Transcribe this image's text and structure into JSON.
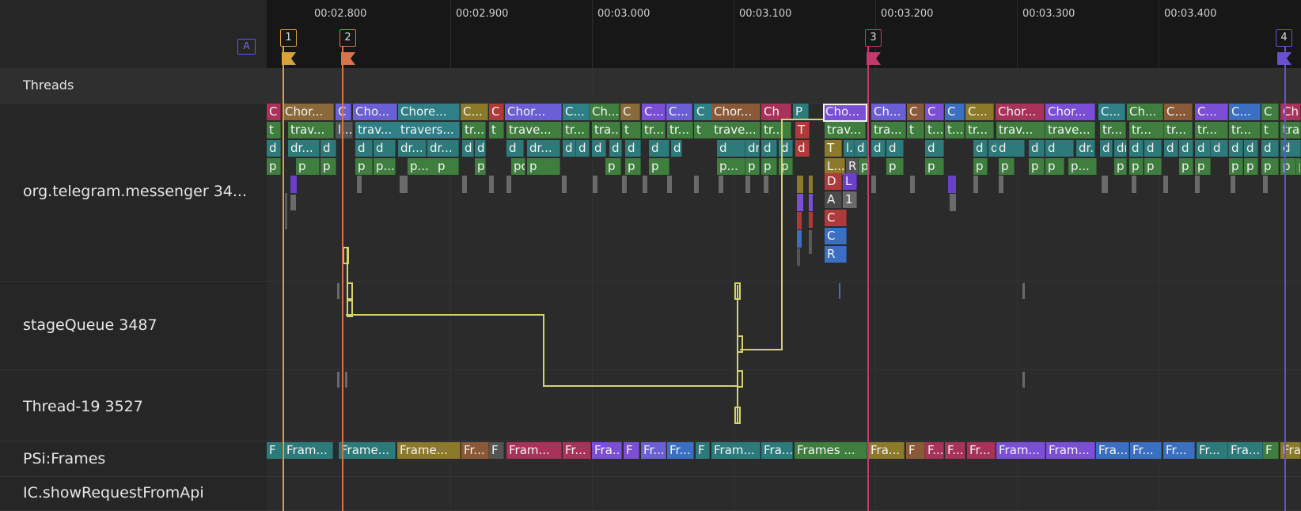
{
  "ruler": {
    "ticks": [
      "00:02.800",
      "00:02.900",
      "00:03.000",
      "00:03.100",
      "00:03.200",
      "00:03.300",
      "00:03.400"
    ]
  },
  "area_badge": "A",
  "flags": [
    "1",
    "2",
    "3",
    "4"
  ],
  "tracks": {
    "threads_section": "Threads",
    "telegram": "org.telegram.messenger 34...",
    "stage_queue": "stageQueue 3487",
    "thread19": "Thread-19 3527",
    "psi_frames": "PSi:Frames",
    "ic_show": "IC.showRequestFromApi"
  },
  "slices": {
    "row0": [
      "C",
      "Chor...",
      "C",
      "Cho...",
      "Chore...",
      "C...",
      "C",
      "Chor...",
      "C...",
      "Ch...",
      "C",
      "C...",
      "C...",
      "C",
      "Chor...",
      "Ch",
      "P",
      "Cho...",
      "Ch...",
      "C",
      "C",
      "C",
      "C...",
      "Chor...",
      "Chor...",
      "C...",
      "Ch...",
      "C...",
      "C...",
      "C...",
      "C",
      "Ch"
    ],
    "row1": [
      "t",
      "trav...",
      "l...",
      "trav...",
      "travers...",
      "tr...",
      "t",
      "trave...",
      "tr...",
      "tra...",
      "t",
      "tr...",
      "tr...",
      "t",
      "trave...",
      "tr...",
      "T",
      "trav...",
      "tra...",
      "t",
      "t...",
      "t...",
      "tr...",
      "trav...",
      "trave...",
      "tr...",
      "tr...",
      "tr...",
      "tr...",
      "tr...",
      "t",
      "tra"
    ],
    "row2": [
      "d",
      "dr...",
      "d",
      "d",
      "d",
      "dr...",
      "dr...",
      "d",
      "d",
      "d",
      "dr...",
      "d",
      "d",
      "d",
      "d",
      "d",
      "d",
      "d",
      "d",
      "dr...",
      "d",
      "d",
      "d",
      "T",
      "l...",
      "d",
      "d",
      "d",
      "d",
      "d",
      "d",
      "d",
      "d",
      "d",
      "dr...",
      "d",
      "dr...",
      "d",
      "d",
      "d",
      "d",
      "d",
      "d",
      "d",
      "d",
      "d",
      "d",
      "d",
      "d",
      "dr"
    ],
    "row3": [
      "p",
      "p",
      "p",
      "p",
      "p...",
      "p...",
      "p",
      "p",
      "po...",
      "p",
      "p",
      "p",
      "p",
      "p...",
      "p",
      "p",
      "p",
      "L...",
      "R",
      "p",
      "p",
      "p",
      "p",
      "p",
      "p",
      "p",
      "p...",
      "p",
      "p",
      "p",
      "p",
      "p",
      "p",
      "p",
      "p",
      "p",
      "p"
    ],
    "stack": [
      "D",
      "A",
      "C",
      "C",
      "R",
      "L",
      "1"
    ],
    "frames": [
      "F",
      "Fram...",
      "Frame...",
      "Frame...",
      "Fr...",
      "F",
      "Fram...",
      "Fr...",
      "Fra...",
      "F",
      "Fr...",
      "Fr...",
      "F",
      "Fram...",
      "Fra...",
      "Frames ...",
      "Fra...",
      "F",
      "F...",
      "F...",
      "Fr...",
      "Fram...",
      "Fram...",
      "Fra...",
      "Fr...",
      "Fr...",
      "Fr...",
      "Fra...",
      "F",
      "Fra"
    ]
  },
  "colors": {
    "flag1": "#d9a33c",
    "flag2": "#d9744a",
    "flag3": "#c23a6b",
    "flag4": "#6a4fd0",
    "flow": "#d6d36a",
    "selected_border": "#f2f2f2"
  }
}
